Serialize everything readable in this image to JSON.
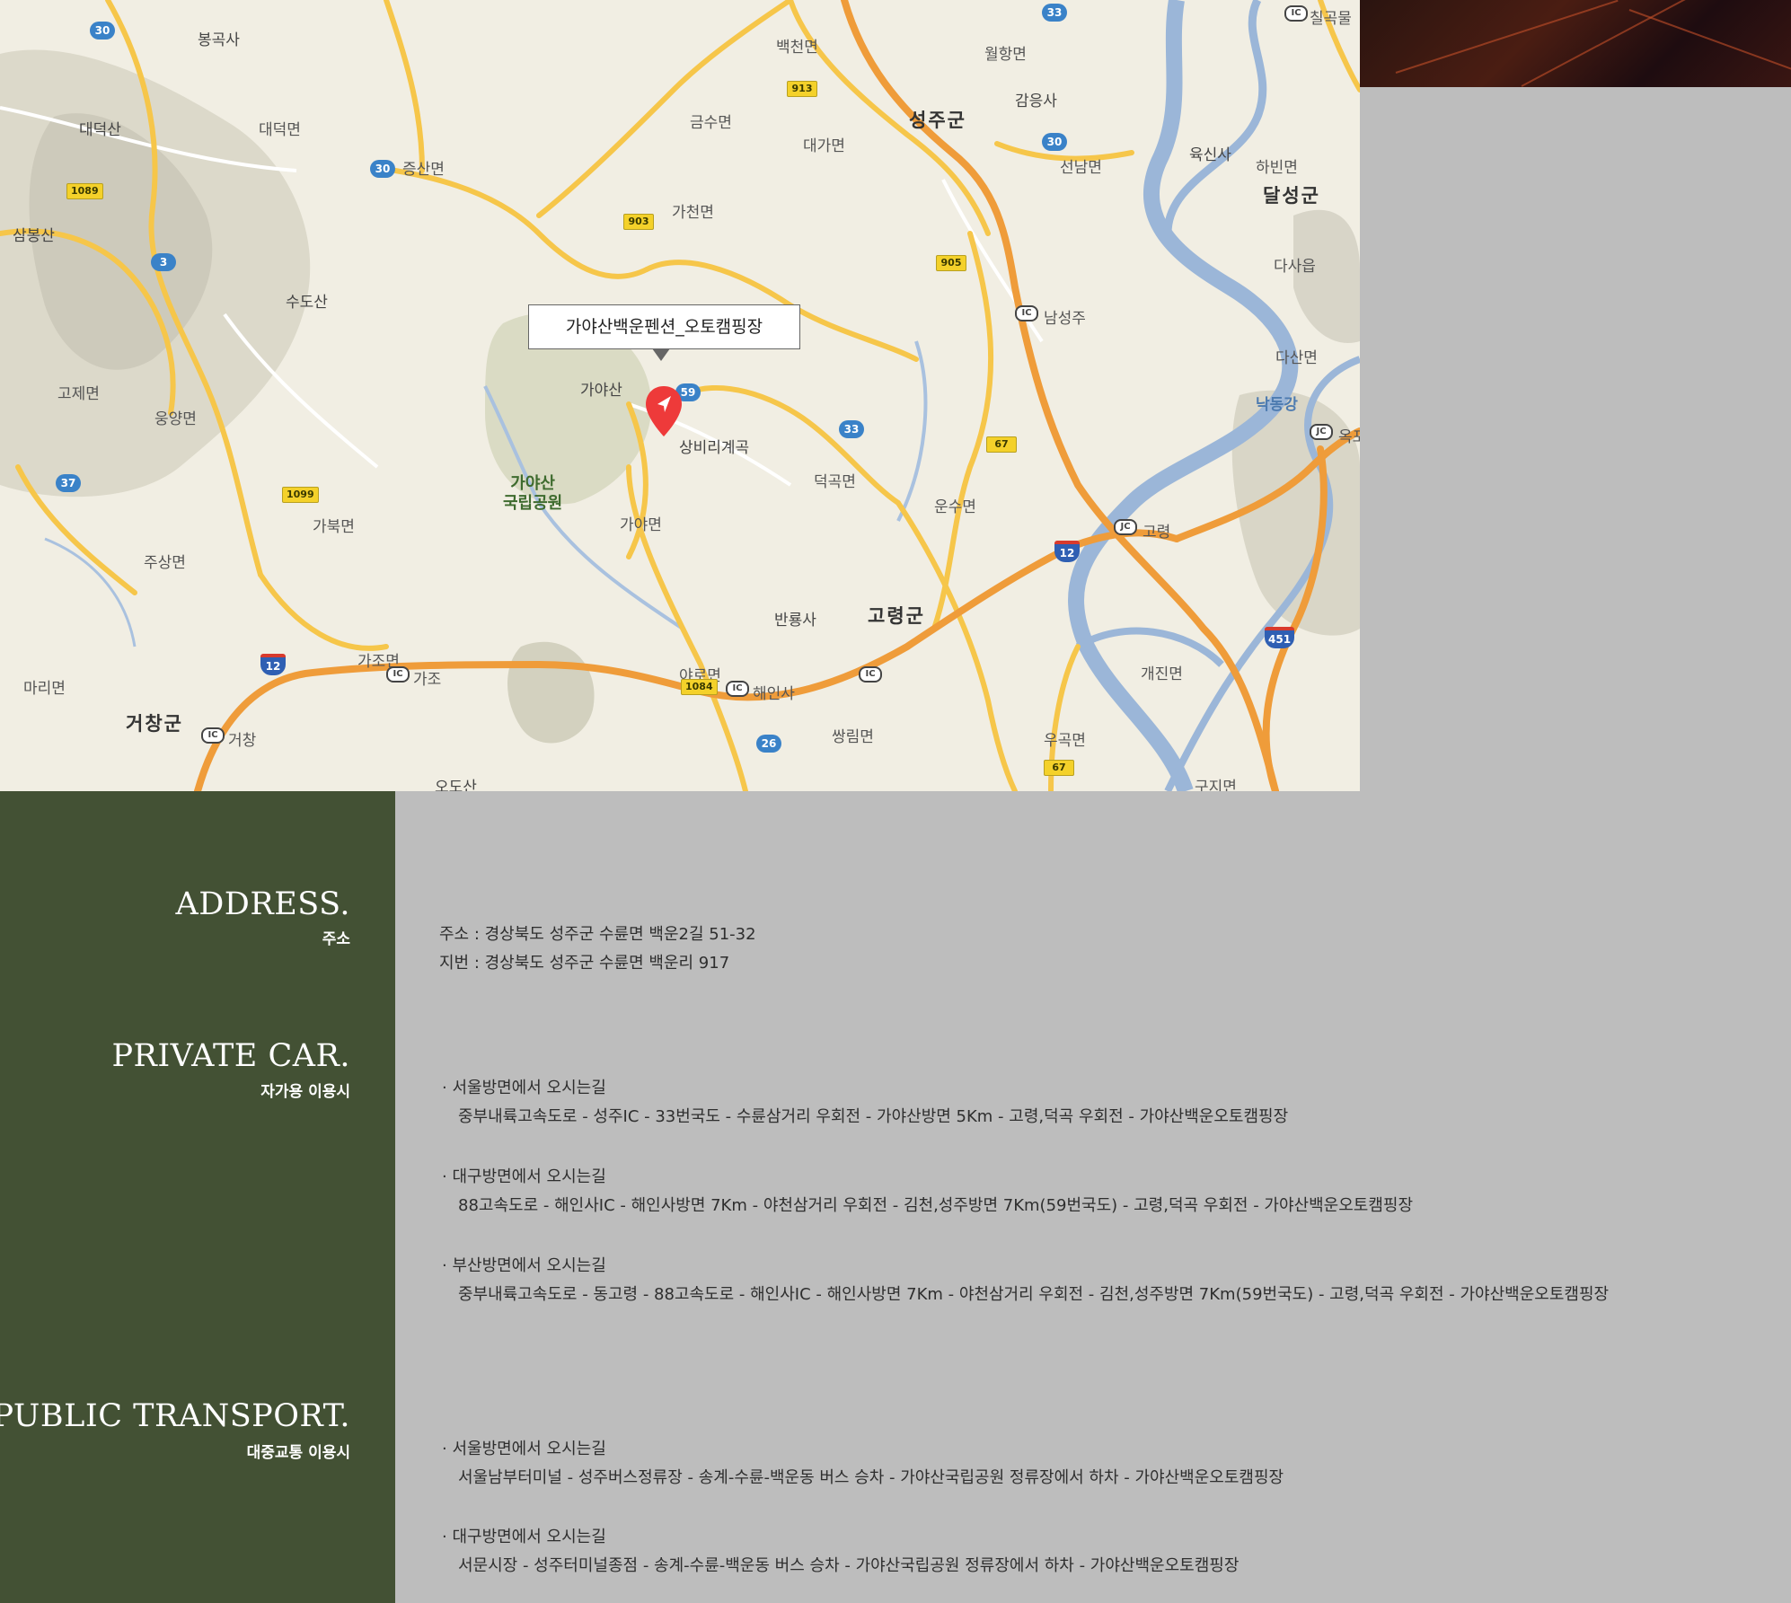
{
  "map": {
    "callout": "가야산백운펜션_오토캠핑장",
    "places": [
      {
        "name": "봉곡사",
        "cls": "poi"
      },
      {
        "name": "대덕산",
        "cls": "poi"
      },
      {
        "name": "대덕면",
        "cls": ""
      },
      {
        "name": "증산면",
        "cls": ""
      },
      {
        "name": "삼봉산",
        "cls": "poi"
      },
      {
        "name": "수도산",
        "cls": "poi"
      },
      {
        "name": "고제면",
        "cls": ""
      },
      {
        "name": "웅양면",
        "cls": ""
      },
      {
        "name": "가북면",
        "cls": ""
      },
      {
        "name": "주상면",
        "cls": ""
      },
      {
        "name": "마리면",
        "cls": ""
      },
      {
        "name": "거창군",
        "cls": "big"
      },
      {
        "name": "가조면",
        "cls": ""
      },
      {
        "name": "오도산",
        "cls": "poi"
      },
      {
        "name": "가야산",
        "cls": "poi"
      },
      {
        "name": "가야면",
        "cls": ""
      },
      {
        "name": "야로면",
        "cls": ""
      },
      {
        "name": "백천면",
        "cls": ""
      },
      {
        "name": "금수면",
        "cls": ""
      },
      {
        "name": "대가면",
        "cls": ""
      },
      {
        "name": "가천면",
        "cls": ""
      },
      {
        "name": "상비리계곡",
        "cls": "poi"
      },
      {
        "name": "덕곡면",
        "cls": ""
      },
      {
        "name": "반룡사",
        "cls": "poi"
      },
      {
        "name": "쌍림면",
        "cls": ""
      },
      {
        "name": "고령군",
        "cls": "big"
      },
      {
        "name": "운수면",
        "cls": ""
      },
      {
        "name": "성주군",
        "cls": "big"
      },
      {
        "name": "월항면",
        "cls": ""
      },
      {
        "name": "감응사",
        "cls": "poi"
      },
      {
        "name": "선남면",
        "cls": ""
      },
      {
        "name": "남성주",
        "cls": ""
      },
      {
        "name": "육신사",
        "cls": "poi"
      },
      {
        "name": "하빈면",
        "cls": ""
      },
      {
        "name": "달성군",
        "cls": "big"
      },
      {
        "name": "다사읍",
        "cls": ""
      },
      {
        "name": "다산면",
        "cls": ""
      },
      {
        "name": "낙동강",
        "cls": "river"
      },
      {
        "name": "옥포",
        "cls": ""
      },
      {
        "name": "고령",
        "cls": ""
      },
      {
        "name": "개진면",
        "cls": ""
      },
      {
        "name": "우곡면",
        "cls": ""
      },
      {
        "name": "구지면",
        "cls": ""
      },
      {
        "name": "칠곡물",
        "cls": ""
      },
      {
        "name": "가조",
        "cls": ""
      },
      {
        "name": "해인사",
        "cls": ""
      },
      {
        "name": "거창",
        "cls": ""
      }
    ],
    "park": "가야산\n국립공원",
    "shields": [
      {
        "t": "30",
        "cls": ""
      },
      {
        "t": "30",
        "cls": ""
      },
      {
        "t": "3",
        "cls": ""
      },
      {
        "t": "37",
        "cls": ""
      },
      {
        "t": "33",
        "cls": ""
      },
      {
        "t": "30",
        "cls": ""
      },
      {
        "t": "59",
        "cls": ""
      },
      {
        "t": "33",
        "cls": ""
      },
      {
        "t": "26",
        "cls": ""
      },
      {
        "t": "1089",
        "cls": "local"
      },
      {
        "t": "1099",
        "cls": "local"
      },
      {
        "t": "903",
        "cls": "local"
      },
      {
        "t": "913",
        "cls": "local"
      },
      {
        "t": "905",
        "cls": "local"
      },
      {
        "t": "67",
        "cls": "local"
      },
      {
        "t": "67",
        "cls": "local"
      },
      {
        "t": "1084",
        "cls": "local"
      },
      {
        "t": "12",
        "cls": "expw"
      },
      {
        "t": "12",
        "cls": "expw"
      },
      {
        "t": "451",
        "cls": "expw"
      },
      {
        "t": "IC",
        "cls": "ic"
      },
      {
        "t": "IC",
        "cls": "ic"
      },
      {
        "t": "IC",
        "cls": "ic"
      },
      {
        "t": "IC",
        "cls": "ic"
      },
      {
        "t": "IC",
        "cls": "ic"
      },
      {
        "t": "IC",
        "cls": "ic"
      },
      {
        "t": "JC",
        "cls": "ic"
      },
      {
        "t": "JC",
        "cls": "ic"
      }
    ]
  },
  "sections": {
    "address": {
      "title": "ADDRESS.",
      "sub": "주소"
    },
    "car": {
      "title": "PRIVATE CAR.",
      "sub": "자가용 이용시"
    },
    "transit": {
      "title": "PUBLIC TRANSPORT.",
      "sub": "대중교통 이용시"
    }
  },
  "address": {
    "road": "주소 : 경상북도 성주군 수륜면 백운2길 51-32",
    "lot": "지번 : 경상북도 성주군 수륜면 백운리 917"
  },
  "car_routes": [
    {
      "head": "· 서울방면에서 오시는길",
      "route": "중부내륙고속도로 - 성주IC - 33번국도 - 수륜삼거리 우회전 - 가야산방면 5Km - 고령,덕곡 우회전 - 가야산백운오토캠핑장"
    },
    {
      "head": "· 대구방면에서 오시는길",
      "route": "88고속도로 - 해인사IC - 해인사방면 7Km - 야천삼거리 우회전 - 김천,성주방면 7Km(59번국도) - 고령,덕곡 우회전 - 가야산백운오토캠핑장"
    },
    {
      "head": "· 부산방면에서 오시는길",
      "route": "중부내륙고속도로 - 동고령 - 88고속도로 - 해인사IC - 해인사방면 7Km - 야천삼거리 우회전 - 김천,성주방면 7Km(59번국도) - 고령,덕곡 우회전 - 가야산백운오토캠핑장"
    }
  ],
  "transit_routes": [
    {
      "head": "· 서울방면에서 오시는길",
      "route": "서울남부터미널 - 성주버스정류장 - 송계-수륜-백운동 버스 승차 - 가야산국립공원 정류장에서 하차 - 가야산백운오토캠핑장"
    },
    {
      "head": "· 대구방면에서 오시는길",
      "route": "서문시장 - 성주터미널종점 - 송계-수륜-백운동 버스 승차 - 가야산국립공원 정류장에서 하차 - 가야산백운오토캠핑장"
    }
  ]
}
